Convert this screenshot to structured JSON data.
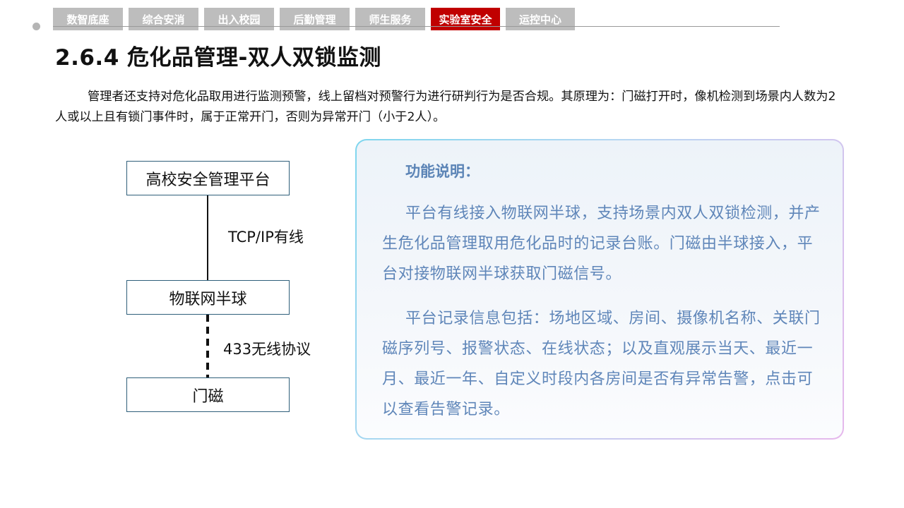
{
  "nav": {
    "tabs": [
      {
        "label": "数智底座",
        "active": false
      },
      {
        "label": "综合安消",
        "active": false
      },
      {
        "label": "出入校园",
        "active": false
      },
      {
        "label": "后勤管理",
        "active": false
      },
      {
        "label": "师生服务",
        "active": false
      },
      {
        "label": "实验室安全",
        "active": true
      },
      {
        "label": "运控中心",
        "active": false
      }
    ],
    "active_color": "#c00000",
    "inactive_color": "#bdbdbd"
  },
  "page_title": "2.6.4 危化品管理-双人双锁监测",
  "intro": "管理者还支持对危化品取用进行监测预警，线上留档对预警行为进行研判行为是否合规。其原理为：门磁打开时，像机检测到场景内人数为2人或以上且有锁门事件时，属于正常开门，否则为异常开门（小于2人）。",
  "diagram": {
    "node_platform": "高校安全管理平台",
    "node_iot": "物联网半球",
    "node_door": "门磁",
    "edge_wired": "TCP/IP有线",
    "edge_wireless": "433无线协议"
  },
  "panel": {
    "heading": "功能说明：",
    "para1": "平台有线接入物联网半球，支持场景内双人双锁检测，并产生危化品管理取用危化品时的记录台账。门磁由半球接入，平台对接物联网半球获取门磁信号。",
    "para2": "平台记录信息包括：场地区域、房间、摄像机名称、关联门磁序列号、报警状态、在线状态；以及直观展示当天、最近一月、最近一年、自定义时段内各房间是否有异常告警，点击可以查看告警记录。"
  }
}
